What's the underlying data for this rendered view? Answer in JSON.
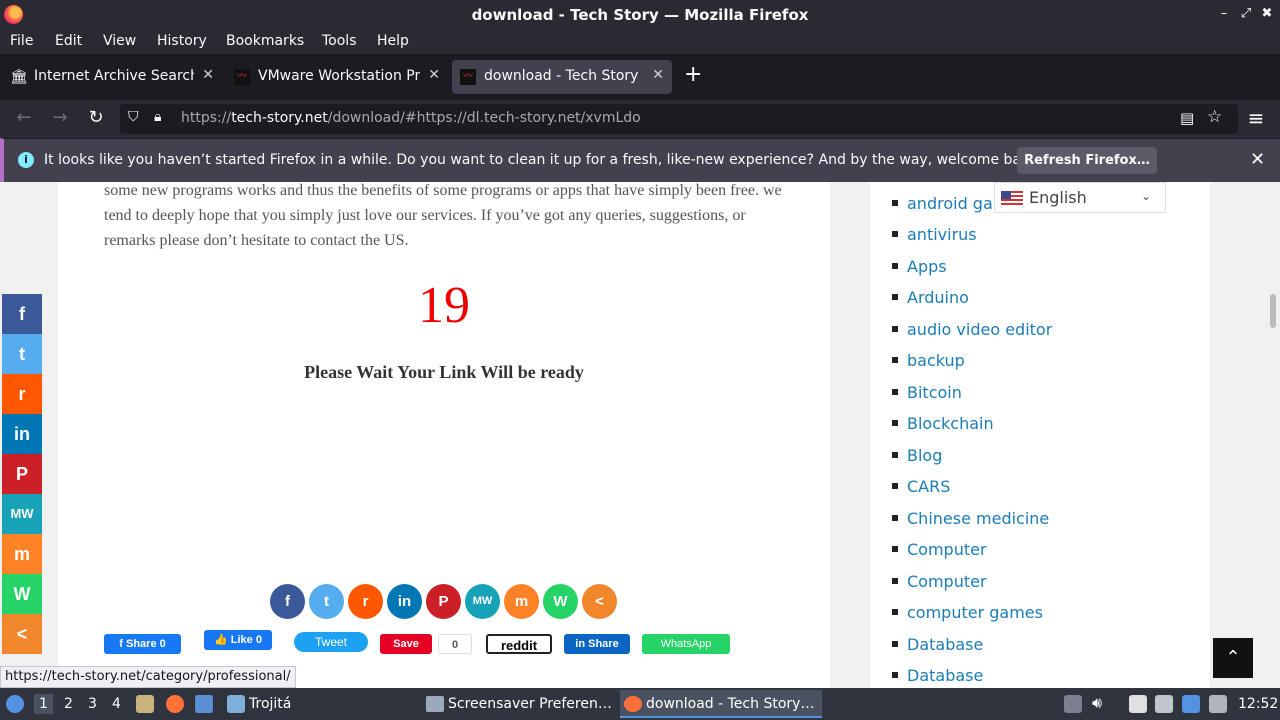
{
  "window": {
    "title": "download - Tech Story — Mozilla Firefox",
    "minimize": "–",
    "maximize": "⤢",
    "close": "✖"
  },
  "menu": [
    "File",
    "Edit",
    "View",
    "History",
    "Bookmarks",
    "Tools",
    "Help"
  ],
  "tabs": [
    {
      "title": "Internet Archive Search: ",
      "icon": "archive-icon",
      "active": false
    },
    {
      "title": "VMware Workstation Pro",
      "icon": "techstory-favicon",
      "active": false
    },
    {
      "title": "download - Tech Story",
      "icon": "techstory-favicon",
      "active": true
    }
  ],
  "tab_close": "✕",
  "new_tab": "+",
  "nav": {
    "back": "←",
    "forward": "→",
    "reload": "↻",
    "menu": "≡"
  },
  "url": {
    "prefix": "https://",
    "domain": "tech-story.net",
    "path": "/download/#https://dl.tech-story.net/xvmLdo"
  },
  "notification": {
    "icon": "i",
    "message": "It looks like you haven’t started Firefox in a while. Do you want to clean it up for a fresh, like-new experience? And by the way, welcome back!",
    "button": "Refresh Firefox…",
    "close": "✕"
  },
  "article": {
    "paragraph": "some new programs works and thus the benefits of some programs or apps that have simply been free. we tend to deeply hope that you simply just love our services. If you’ve got any queries, suggestions, or remarks please don’t hesitate to contact the US.",
    "countdown": "19",
    "wait_message": "Please Wait Your Link Will be ready"
  },
  "share_circles": [
    {
      "name": "facebook",
      "glyph": "f",
      "color": "#3b5998"
    },
    {
      "name": "twitter",
      "glyph": "t",
      "color": "#55acee"
    },
    {
      "name": "reddit",
      "glyph": "r",
      "color": "#ff5700"
    },
    {
      "name": "linkedin",
      "glyph": "in",
      "color": "#0077b5"
    },
    {
      "name": "pinterest",
      "glyph": "P",
      "color": "#cb2027"
    },
    {
      "name": "mewe",
      "glyph": "MW",
      "color": "#17a2b8"
    },
    {
      "name": "mix",
      "glyph": "m",
      "color": "#ff8226"
    },
    {
      "name": "whatsapp",
      "glyph": "W",
      "color": "#25d366"
    },
    {
      "name": "share",
      "glyph": "<",
      "color": "#f2862b"
    }
  ],
  "share_buttons": {
    "fb_share": "f Share 0",
    "fb_like": "👍 Like 0",
    "tweet": "Tweet",
    "pin_save": "Save",
    "pin_count": "0",
    "reddit": "reddit",
    "linkedin_share": "in Share",
    "whatsapp": "WhatsApp"
  },
  "language": {
    "label": "English",
    "chevron": "⌄"
  },
  "categories": [
    "android gar",
    "antivirus",
    "Apps",
    "Arduino",
    "audio video editor",
    "backup",
    "Bitcoin",
    "Blockchain",
    "Blog",
    "CARS",
    "Chinese medicine",
    "Computer",
    "Computer",
    "computer games",
    "Database",
    "Database"
  ],
  "floating_social": [
    {
      "name": "facebook",
      "glyph": "f",
      "color": "#3b5998"
    },
    {
      "name": "twitter",
      "glyph": "t",
      "color": "#55acee"
    },
    {
      "name": "reddit",
      "glyph": "r",
      "color": "#ff5700"
    },
    {
      "name": "linkedin",
      "glyph": "in",
      "color": "#0077b5"
    },
    {
      "name": "pinterest",
      "glyph": "P",
      "color": "#cb2027"
    },
    {
      "name": "mewe",
      "glyph": "MW",
      "color": "#17a2b8"
    },
    {
      "name": "mix",
      "glyph": "m",
      "color": "#ff8226"
    },
    {
      "name": "whatsapp",
      "glyph": "W",
      "color": "#25d366"
    },
    {
      "name": "share",
      "glyph": "<",
      "color": "#f2862b"
    }
  ],
  "back_to_top": "⌃",
  "status_link": "https://tech-story.net/category/professional/",
  "taskbar": {
    "workspaces": [
      "1",
      "2",
      "3",
      "4"
    ],
    "trojita": "Trojitá",
    "windows": [
      {
        "title": "Screensaver Preferen…",
        "active": false
      },
      {
        "title": "download - Tech Story…",
        "active": true
      }
    ],
    "clock": "12:52"
  }
}
